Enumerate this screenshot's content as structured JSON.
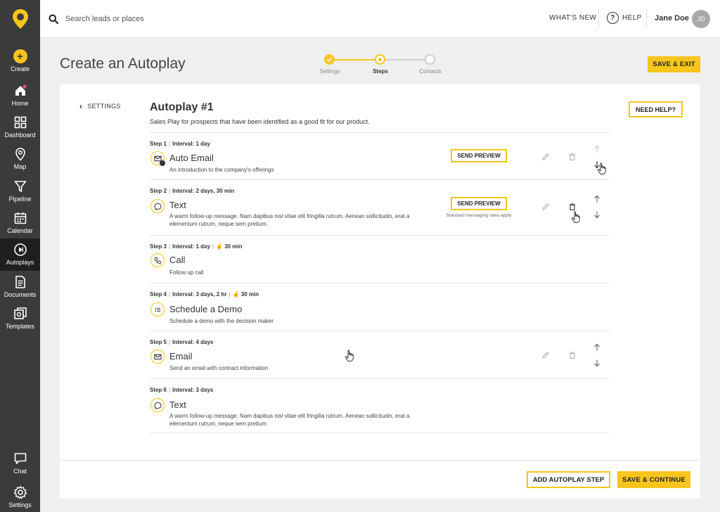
{
  "sidebar": {
    "logo": "location-pin-logo",
    "items": [
      {
        "label": "Create",
        "icon": "plus-icon"
      },
      {
        "label": "Home",
        "icon": "home-icon"
      },
      {
        "label": "Dashboard",
        "icon": "dashboard-icon"
      },
      {
        "label": "Map",
        "icon": "map-pin-icon"
      },
      {
        "label": "Pipeline",
        "icon": "funnel-icon"
      },
      {
        "label": "Calendar",
        "icon": "calendar-icon"
      },
      {
        "label": "Autoplays",
        "icon": "play-circle-icon"
      },
      {
        "label": "Documents",
        "icon": "document-icon"
      },
      {
        "label": "Templates",
        "icon": "templates-icon"
      }
    ],
    "bottom": [
      {
        "label": "Chat",
        "icon": "chat-icon"
      },
      {
        "label": "Settings",
        "icon": "gear-icon"
      }
    ]
  },
  "topbar": {
    "search_placeholder": "Search leads or places",
    "whats_new": "WHAT'S NEW",
    "help": "HELP",
    "user_name": "Jane Doe",
    "avatar_initials": "JD"
  },
  "header": {
    "title": "Create an Autoplay",
    "steps": [
      "Settings",
      "Steps",
      "Contacts"
    ],
    "current_step": "Steps",
    "save_exit": "SAVE & EXIT"
  },
  "card": {
    "back": "SETTINGS",
    "title": "Autoplay #1",
    "description": "Sales Play for prospects that have been identified as a good fit for our product.",
    "need_help": "NEED HELP?",
    "send_preview": "SEND PREVIEW",
    "rates_note": "Standard messaging rates apply",
    "steps": [
      {
        "label": "Step 1",
        "interval": "Interval: 1 day",
        "duration": "",
        "name": "Auto Email",
        "icon": "auto-email-icon",
        "desc": "An introduction to the company's offerings"
      },
      {
        "label": "Step 2",
        "interval": "Interval: 2 days, 30 min",
        "duration": "",
        "name": "Text",
        "icon": "chat-bubble-icon",
        "desc": "A warm follow-up message.  Nam dapibus nisl vitae elit fringilla rutrum. Aenean sollicitudin, erat a elementum rutrum, neque sem pretium."
      },
      {
        "label": "Step 3",
        "interval": "Interval: 1 day",
        "duration": "30 min",
        "name": "Call",
        "icon": "phone-icon",
        "desc": "Follow up call"
      },
      {
        "label": "Step 4",
        "interval": "Interval: 3 days, 2 hr",
        "duration": "30 min",
        "name": "Schedule a Demo",
        "icon": "list-icon",
        "desc": "Schedule a demo with the decision maker"
      },
      {
        "label": "Step 5",
        "interval": "Interval: 4 days",
        "duration": "",
        "name": "Email",
        "icon": "envelope-icon",
        "desc": "Send an email with contract information"
      },
      {
        "label": "Step 6",
        "interval": "Interval: 3 days",
        "duration": "",
        "name": "Text",
        "icon": "chat-bubble-icon",
        "desc": "A warm follow-up message.  Nam dapibus nisl vitae elit fringilla rutrum. Aenean sollicitudin, erat a elementum rutrum, neque sem pretium."
      }
    ],
    "add_step": "ADD AUTOPLAY STEP",
    "save_continue": "SAVE & CONTINUE"
  },
  "colors": {
    "accent": "#f7c51e",
    "sidebar": "#3b3b3b",
    "sidebar_active": "#1f1f1f"
  }
}
